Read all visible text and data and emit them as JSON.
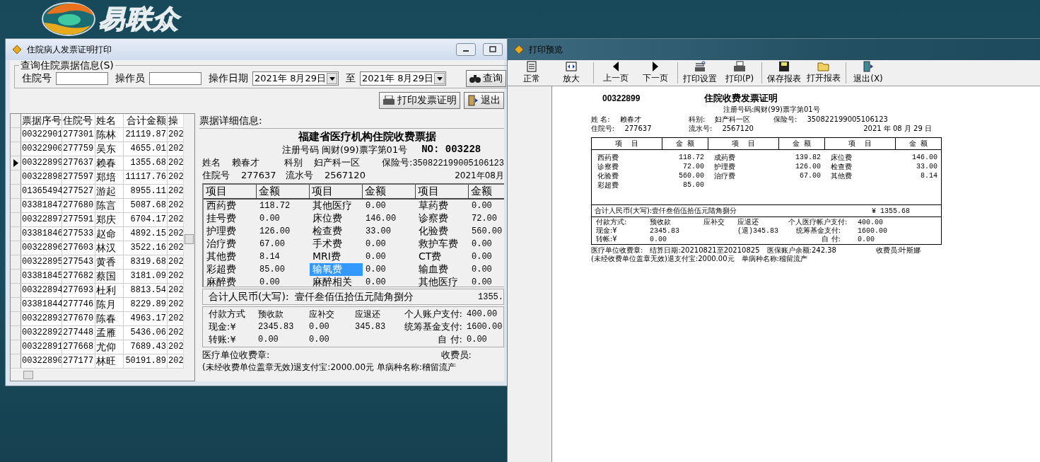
{
  "logo": {
    "text": "易联众"
  },
  "invoice_window": {
    "title": "住院病人发票证明打印",
    "query": {
      "title": "查询住院票据信息(S)",
      "fields": [
        {
          "label": "住院号"
        },
        {
          "label": "操作员"
        }
      ],
      "date_label": "操作日期",
      "date_from": "2021年 8月29日",
      "to_label": "至",
      "date_to": "2021年 8月29日",
      "search_button": "查询"
    },
    "buttons": [
      "打印发票证明",
      "退出"
    ],
    "list": {
      "columns": [
        "票据序号",
        "住院号",
        "姓名",
        "合计金额",
        "操"
      ],
      "rows": [
        {
          "cells": [
            "00322901",
            "277301",
            "陈林",
            "21119.87",
            "202"
          ],
          "selected": false
        },
        {
          "cells": [
            "00322900",
            "277759",
            "吴东",
            "4655.01",
            "202"
          ],
          "selected": false
        },
        {
          "cells": [
            "00322899",
            "277637",
            "赖春",
            "1355.68",
            "202"
          ],
          "selected": true
        },
        {
          "cells": [
            "00322898",
            "277597",
            "郑培",
            "11117.76",
            "202"
          ],
          "selected": false
        },
        {
          "cells": [
            "01365494",
            "277527",
            "游起",
            "8955.11",
            "202"
          ],
          "selected": false
        },
        {
          "cells": [
            "03381847",
            "277680",
            "陈言",
            "5087.68",
            "202"
          ],
          "selected": false
        },
        {
          "cells": [
            "00322897",
            "277591",
            "郑庆",
            "6704.17",
            "202"
          ],
          "selected": false
        },
        {
          "cells": [
            "03381846",
            "277533",
            "赵命",
            "4892.15",
            "202"
          ],
          "selected": false
        },
        {
          "cells": [
            "00322896",
            "277603",
            "林汉",
            "3522.16",
            "202"
          ],
          "selected": false
        },
        {
          "cells": [
            "00322895",
            "277543",
            "黄香",
            "8319.68",
            "202"
          ],
          "selected": false
        },
        {
          "cells": [
            "03381845",
            "277682",
            "蔡国",
            "3181.09",
            "202"
          ],
          "selected": false
        },
        {
          "cells": [
            "00322894",
            "277693",
            "杜利",
            "8813.54",
            "202"
          ],
          "selected": false
        },
        {
          "cells": [
            "03381844",
            "277746",
            "陈月",
            "8229.89",
            "202"
          ],
          "selected": false
        },
        {
          "cells": [
            "00322893",
            "277670",
            "陈春",
            "4963.17",
            "202"
          ],
          "selected": false
        },
        {
          "cells": [
            "00322892",
            "277448",
            "孟雁",
            "5436.06",
            "202"
          ],
          "selected": false
        },
        {
          "cells": [
            "00322891",
            "277668",
            "尤仰",
            "7689.43",
            "202"
          ],
          "selected": false
        },
        {
          "cells": [
            "00322890",
            "277177",
            "林旺",
            "50191.89",
            "202"
          ],
          "selected": false
        }
      ]
    },
    "detail": {
      "heading": "票据详细信息:",
      "title": "福建省医疗机构住院收费票据",
      "reg": "注册号码 闽财(99)票字第01号",
      "no": "NO: 003228",
      "info_rows": [
        [
          {
            "label": "姓名",
            "value": "赖春才"
          },
          {
            "label": "科别",
            "value": "妇产科一区"
          },
          {
            "label": "保险号:",
            "value": "350822199005106123"
          }
        ],
        [
          {
            "label": "住院号",
            "value": "277637"
          },
          {
            "label": "流水号",
            "value": "2567120"
          }
        ]
      ],
      "date": "2021年08月",
      "fee_headers": [
        "项目",
        "金额",
        "项目",
        "金额",
        "项目",
        "金额"
      ],
      "fees": [
        [
          {
            "item": "西药费",
            "amount": "118.72",
            "selected": false
          },
          {
            "item": "其他医疗",
            "amount": "0.00",
            "selected": false
          },
          {
            "item": "草药费",
            "amount": "0.00",
            "selected": false
          }
        ],
        [
          {
            "item": "挂号费",
            "amount": "0.00",
            "selected": false
          },
          {
            "item": "床位费",
            "amount": "146.00",
            "selected": false
          },
          {
            "item": "诊察费",
            "amount": "72.00",
            "selected": false
          }
        ],
        [
          {
            "item": "护理费",
            "amount": "126.00",
            "selected": false
          },
          {
            "item": "检查费",
            "amount": "33.00",
            "selected": false
          },
          {
            "item": "化验费",
            "amount": "560.00",
            "selected": false
          }
        ],
        [
          {
            "item": "治疗费",
            "amount": "67.00",
            "selected": false
          },
          {
            "item": "手术费",
            "amount": "0.00",
            "selected": false
          },
          {
            "item": "救护车费",
            "amount": "0.00",
            "selected": false
          }
        ],
        [
          {
            "item": "其他费",
            "amount": "8.14",
            "selected": false
          },
          {
            "item": "MRI费",
            "amount": "0.00",
            "selected": false
          },
          {
            "item": "CT费",
            "amount": "0.00",
            "selected": false
          }
        ],
        [
          {
            "item": "彩超费",
            "amount": "85.00",
            "selected": false
          },
          {
            "item": "输氧费",
            "amount": "0.00",
            "selected": true
          },
          {
            "item": "输血费",
            "amount": "0.00",
            "selected": false
          }
        ],
        [
          {
            "item": "麻醉费",
            "amount": "0.00",
            "selected": false
          },
          {
            "item": "麻醉相关",
            "amount": "0.00",
            "selected": false
          },
          {
            "item": "其他医疗",
            "amount": "0.00",
            "selected": false
          }
        ]
      ],
      "total": {
        "label": "合计人民币(大写):",
        "words": "壹仟叁佰伍拾伍元陆角捌分",
        "amount": "1355."
      },
      "payment": [
        {
          "method": "付款方式",
          "prepaid": "预收款",
          "supplement": "应补交",
          "refund": "应退还",
          "fund_label": "个人账户支付:",
          "fund_value": "400.00"
        },
        {
          "method": "现金:¥",
          "prepaid": "2345.83",
          "supplement": "0.00",
          "refund": "345.83",
          "fund_label": "统筹基金支付:",
          "fund_value": "1600.00"
        },
        {
          "method": "转账:¥",
          "prepaid": "0.00",
          "supplement": "0.00",
          "fund_label": "自  付:",
          "fund_value": "0.00"
        }
      ],
      "stamp": "医疗单位收费章:",
      "cashier": "收费员:",
      "note": "(未经收费单位盖章无效)退支付宝:2000.00元   单病种名称:稽留流产"
    }
  },
  "preview_window": {
    "title": "打印预览",
    "toolbar": [
      {
        "label": "正常",
        "kind": "page"
      },
      {
        "label": "放大",
        "kind": "zoom"
      },
      {
        "label": "上一页",
        "kind": "prev"
      },
      {
        "label": "下一页",
        "kind": "next"
      },
      {
        "label": "打印设置",
        "kind": "setup"
      },
      {
        "label": "打印(P)",
        "kind": "print"
      },
      {
        "label": "保存报表",
        "kind": "save"
      },
      {
        "label": "打开报表",
        "kind": "open"
      },
      {
        "label": "退出(X)",
        "kind": "exit"
      }
    ],
    "page": {
      "number": "00322899",
      "title": "住院收费发票证明",
      "reg": "注册号码:闽财(99)票字第01号",
      "info_rows": [
        [
          {
            "label": "姓  名:",
            "value": "赖春才"
          },
          {
            "label": "科别:",
            "value": "妇产科一区"
          },
          {
            "label": "保险号:",
            "value": "350822199005106123"
          }
        ],
        [
          {
            "label": "住院号:",
            "value": "277637"
          },
          {
            "label": "流水号:",
            "value": "2567120"
          }
        ]
      ],
      "date": "2021 年    08 月    29 日",
      "headers": [
        "项    目",
        "金  额",
        "项    目",
        "金  额",
        "项    目",
        "金  额"
      ],
      "fees": [
        [
          {
            "item": "西药费",
            "amount": "118.72"
          },
          {
            "item": "成药费",
            "amount": "139.82"
          },
          {
            "item": "床位费",
            "amount": "146.00"
          }
        ],
        [
          {
            "item": "诊察费",
            "amount": "72.00"
          },
          {
            "item": "护理费",
            "amount": "126.00"
          },
          {
            "item": "检查费",
            "amount": "33.00"
          }
        ],
        [
          {
            "item": "化验费",
            "amount": "560.00"
          },
          {
            "item": "治疗费",
            "amount": "67.00"
          },
          {
            "item": "其他费",
            "amount": "8.14"
          }
        ],
        [
          {
            "item": "彩超费",
            "amount": "85.00"
          }
        ]
      ],
      "total": {
        "label": "合计人民币(大写):",
        "words": "壹仟叁佰伍拾伍元陆角捌分",
        "amount": "¥ 1355.68"
      },
      "payment": [
        {
          "method": "付款方式:",
          "prepaid": "预收款",
          "supplement": "应补交",
          "refund": "应退还",
          "fund_label": "个人医疗帐户支付:",
          "fund_value": "400.00"
        },
        {
          "method": "现金:¥",
          "prepaid": "2345.83",
          "refund": "(退)345.83",
          "fund_label": "统筹基金支付:",
          "fund_value": "1600.00"
        },
        {
          "method": "转帐:¥",
          "prepaid": "0.00",
          "fund_label": "自  付:",
          "fund_value": "0.00"
        }
      ],
      "footer": [
        [
          "医疗单位收费章:",
          "结算日期:20210821至20210825",
          "医保账户余额:242.38",
          "收费员:叶斯娜"
        ],
        [
          "(未经收费单位盖章无效)退支付宝:2000.00元",
          "单病种名称:稽留流产"
        ]
      ]
    }
  }
}
